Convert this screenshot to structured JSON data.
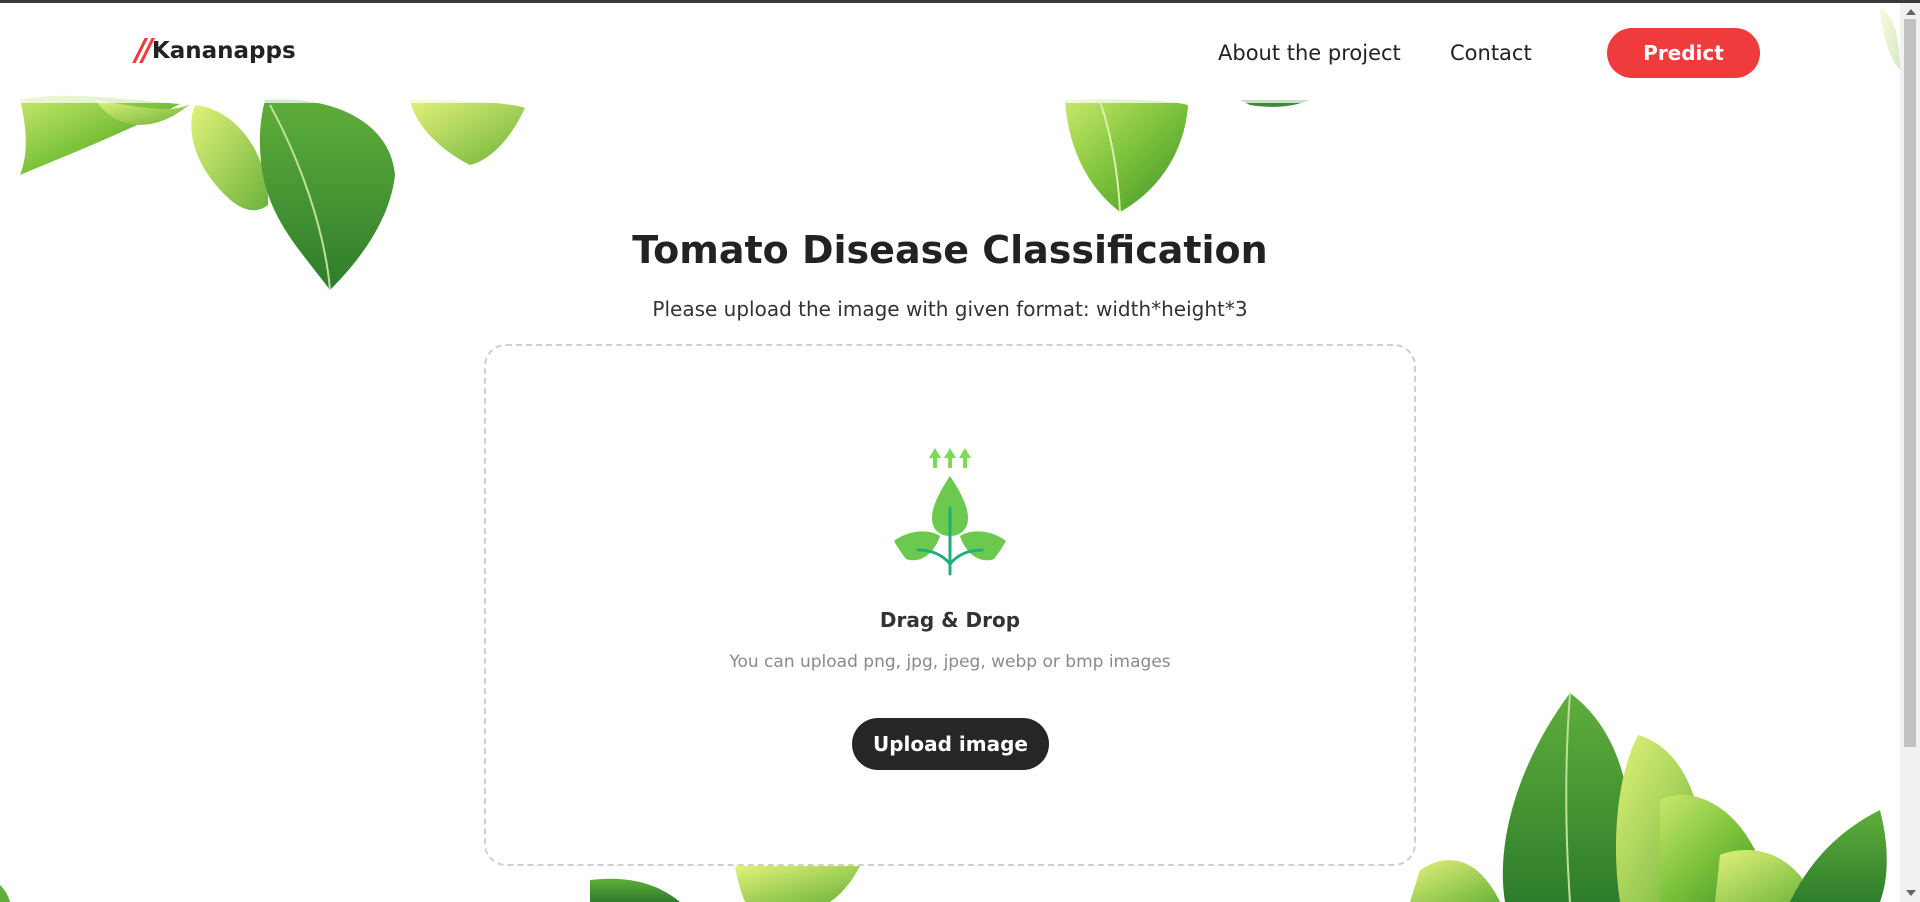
{
  "nav": {
    "logo_mark": "//",
    "brand": "Kananapps",
    "about_label": "About the project",
    "contact_label": "Contact",
    "predict_label": "Predict"
  },
  "main": {
    "title": "Tomato Disease Classification",
    "subtitle": "Please upload the image with given format: width*height*3"
  },
  "dropzone": {
    "icon": "plant-upload-icon",
    "heading": "Drag & Drop",
    "formats_text": "You can upload png, jpg, jpeg, webp or bmp images",
    "upload_label": "Upload image"
  },
  "colors": {
    "accent": "#ef3b3b",
    "button_dark": "#262626",
    "leaf_green": "#5cb83a",
    "icon_green": "#7ed957"
  }
}
